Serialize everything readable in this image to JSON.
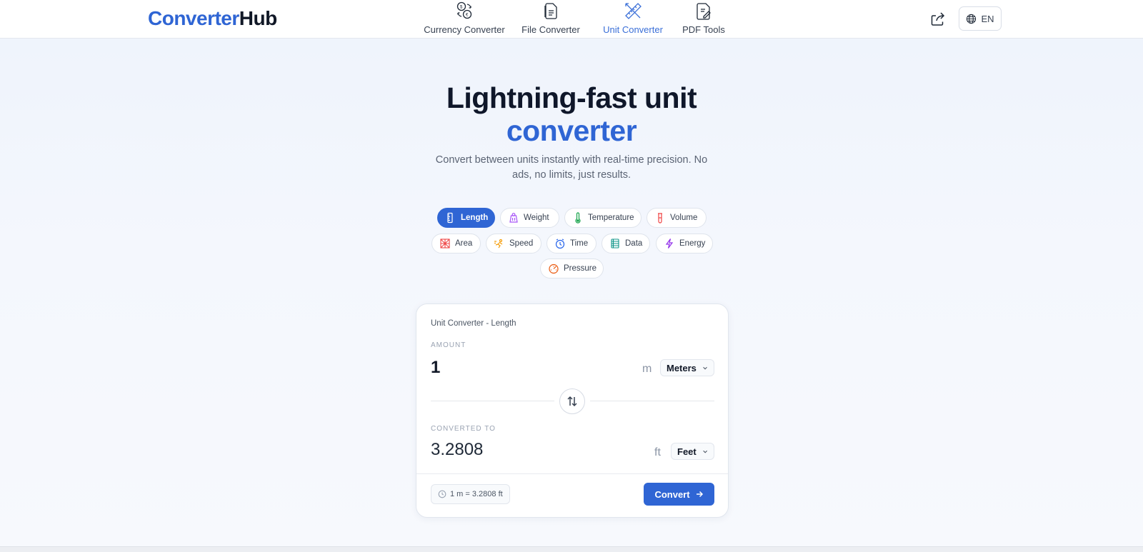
{
  "brand": {
    "part1": "Converter",
    "part2": "Hub"
  },
  "nav": {
    "items": [
      {
        "label": "Currency Converter",
        "icon": "coins-exchange-icon",
        "active": false
      },
      {
        "label": "File Converter",
        "icon": "file-icon",
        "active": false
      },
      {
        "label": "Unit Converter",
        "icon": "ruler-pencil-icon",
        "active": true
      },
      {
        "label": "PDF Tools",
        "icon": "pdf-edit-icon",
        "active": false
      }
    ],
    "language": "EN"
  },
  "hero": {
    "title_line1": "Lightning-fast unit",
    "title_line2": "converter",
    "subtitle": "Convert between units instantly with real-time precision. No ads, no limits, just results."
  },
  "categories": [
    {
      "label": "Length",
      "icon": "ruler-icon",
      "active": true,
      "color": "#ffffff"
    },
    {
      "label": "Weight",
      "icon": "weight-icon",
      "active": false,
      "color": "#a855f7"
    },
    {
      "label": "Temperature",
      "icon": "thermometer-icon",
      "active": false,
      "color": "#16a34a"
    },
    {
      "label": "Volume",
      "icon": "beaker-icon",
      "active": false,
      "color": "#ef4444"
    },
    {
      "label": "Area",
      "icon": "area-icon",
      "active": false,
      "color": "#ef4444"
    },
    {
      "label": "Speed",
      "icon": "speed-icon",
      "active": false,
      "color": "#f59e0b"
    },
    {
      "label": "Time",
      "icon": "clock-icon",
      "active": false,
      "color": "#2563eb"
    },
    {
      "label": "Data",
      "icon": "database-icon",
      "active": false,
      "color": "#0d9488"
    },
    {
      "label": "Energy",
      "icon": "lightning-icon",
      "active": false,
      "color": "#9333ea"
    },
    {
      "label": "Pressure",
      "icon": "gauge-icon",
      "active": false,
      "color": "#ea580c"
    }
  ],
  "converter": {
    "title": "Unit Converter - Length",
    "amount_label": "AMOUNT",
    "amount_value": "1",
    "from_symbol": "m",
    "from_unit": "Meters",
    "result_label": "CONVERTED TO",
    "result_value": "3.2808",
    "to_symbol": "ft",
    "to_unit": "Feet",
    "rate_text": "1 m = 3.2808 ft",
    "convert_label": "Convert"
  },
  "colors": {
    "accent": "#2f65d4",
    "text": "#111827",
    "muted": "#5b6474"
  }
}
